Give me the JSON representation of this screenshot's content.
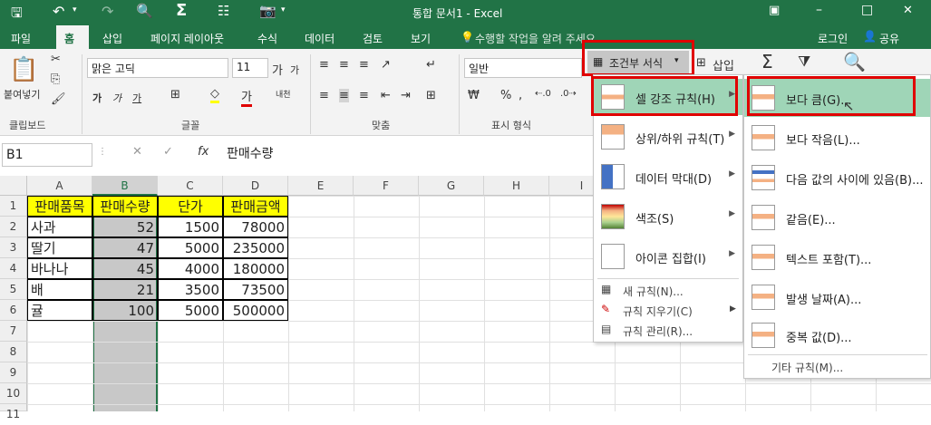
{
  "titlebar": {
    "title": "통합 문서1 - Excel",
    "icons": [
      "save-icon",
      "undo-icon",
      "redo-icon",
      "print-preview-icon",
      "sum-icon",
      "form-icon",
      "camera-icon"
    ],
    "restore": "□",
    "minimize": "–",
    "close": "✕"
  },
  "tabs": [
    "파일",
    "홈",
    "삽입",
    "페이지 레이아웃",
    "수식",
    "데이터",
    "검토",
    "보기"
  ],
  "tellme": "수행할 작업을 알려 주세요",
  "login": "로그인",
  "share": "공유",
  "ribbon": {
    "paste": "붙여넣기",
    "clipboard": "클립보드",
    "font_name": "맑은 고딕",
    "font_size": "11",
    "font_group": "글꼴",
    "align_group": "맞춤",
    "number_format": "일반",
    "number_group": "표시 형식",
    "cond_format": "조건부 서식",
    "insert": "삽입",
    "grow": "가",
    "shrink": "가",
    "bold": "가",
    "italic": "가",
    "underline": "가",
    "phonetic": "내천",
    "currency": "₩",
    "percent": "%",
    "comma": ","
  },
  "namebox": "B1",
  "fx": "fx",
  "formula": "판매수량",
  "columns": [
    "A",
    "B",
    "C",
    "D",
    "E",
    "F",
    "G",
    "H",
    "I"
  ],
  "rows": [
    "1",
    "2",
    "3",
    "4",
    "5",
    "6",
    "7",
    "8",
    "9",
    "10",
    "11"
  ],
  "table": {
    "headers": [
      "판매품목",
      "판매수량",
      "단가",
      "판매금액"
    ],
    "rows": [
      [
        "사과",
        "52",
        "1500",
        "78000"
      ],
      [
        "딸기",
        "47",
        "5000",
        "235000"
      ],
      [
        "바나나",
        "45",
        "4000",
        "180000"
      ],
      [
        "배",
        "21",
        "3500",
        "73500"
      ],
      [
        "귤",
        "100",
        "5000",
        "500000"
      ]
    ]
  },
  "menu1": {
    "items": [
      "셀 강조 규칙(H)",
      "상위/하위 규칙(T)",
      "데이터 막대(D)",
      "색조(S)",
      "아이콘 집합(I)"
    ],
    "small": [
      "새 규칙(N)...",
      "규칙 지우기(C)",
      "규칙 관리(R)..."
    ]
  },
  "menu2": {
    "items": [
      "보다 큼(G)...",
      "보다 작음(L)...",
      "다음 값의 사이에 있음(B)...",
      "같음(E)...",
      "텍스트 포함(T)...",
      "발생 날짜(A)...",
      "중복 값(D)..."
    ],
    "more": "기타 규칙(M)..."
  },
  "colors": {
    "excel_green": "#217346",
    "highlight": "#9fd5b7",
    "yellow": "#ffff00",
    "red": "#e00000",
    "selected_gray": "#c8c8c8"
  }
}
